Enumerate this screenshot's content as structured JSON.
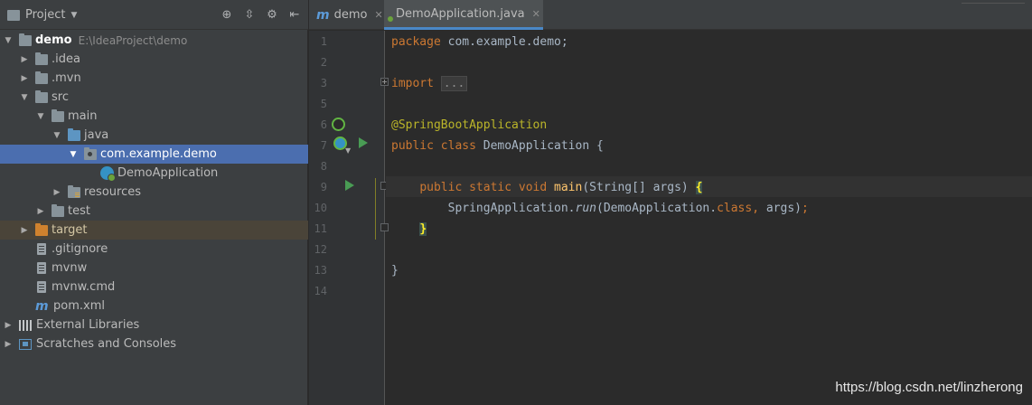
{
  "project_panel": {
    "title": "Project",
    "tree": [
      {
        "label": "demo",
        "path": "E:\\IdeaProject\\demo",
        "expanded": true
      },
      {
        "label": ".idea"
      },
      {
        "label": ".mvn"
      },
      {
        "label": "src"
      },
      {
        "label": "main"
      },
      {
        "label": "java"
      },
      {
        "label": "com.example.demo"
      },
      {
        "label": "DemoApplication"
      },
      {
        "label": "resources"
      },
      {
        "label": "test"
      },
      {
        "label": "target"
      },
      {
        "label": ".gitignore"
      },
      {
        "label": "mvnw"
      },
      {
        "label": "mvnw.cmd"
      },
      {
        "label": "pom.xml"
      },
      {
        "label": "External Libraries"
      },
      {
        "label": "Scratches and Consoles"
      }
    ]
  },
  "tabs": [
    {
      "label": "demo",
      "active": false
    },
    {
      "label": "DemoApplication.java",
      "active": true
    }
  ],
  "line_numbers": [
    "1",
    "2",
    "3",
    "5",
    "6",
    "7",
    "8",
    "9",
    "10",
    "11",
    "12",
    "13",
    "14"
  ],
  "code": {
    "l1_kw": "package",
    "l1_rest": " com.example.demo;",
    "l3_kw": "import",
    "l3_fold": "...",
    "l6": "@SpringBootApplication",
    "l7_kw": "public class",
    "l7_rest": " DemoApplication {",
    "l9_kw": "public static void",
    "l9_m": "main",
    "l9_rest": "(String[] args) ",
    "l9_brace": "{",
    "l10_a": "SpringApplication.",
    "l10_run": "run",
    "l10_b": "(DemoApplication.",
    "l10_cls": "class,",
    "l10_c": " args)",
    "l10_semi": ";",
    "l11": "}",
    "l13": "}"
  },
  "watermark": "https://blog.csdn.net/linzherong"
}
